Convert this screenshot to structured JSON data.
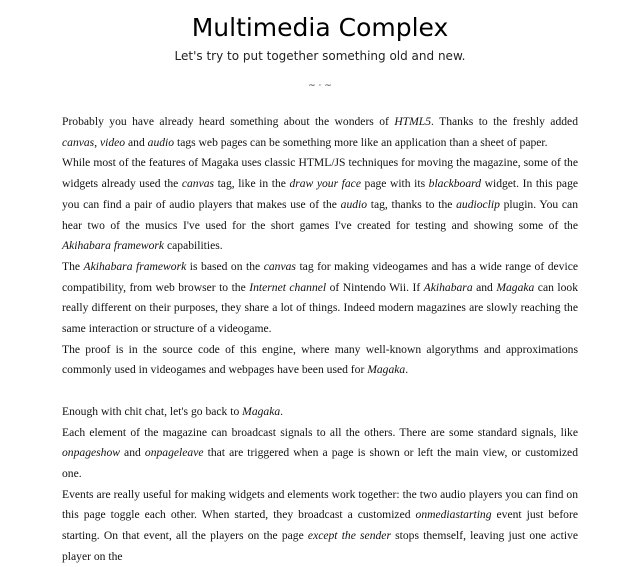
{
  "header": {
    "title": "Multimedia Complex",
    "subtitle": "Let's try to put together something old and new.",
    "divider": "~ · ~"
  },
  "paragraphs": [
    [
      {
        "t": "Probably you have already heard something about the wonders of "
      },
      {
        "t": "HTML5",
        "i": true
      },
      {
        "t": ". Thanks to the freshly added "
      },
      {
        "t": "canvas",
        "i": true
      },
      {
        "t": ", "
      },
      {
        "t": "video",
        "i": true
      },
      {
        "t": " and "
      },
      {
        "t": "audio",
        "i": true
      },
      {
        "t": " tags web pages can be something more like an application than a sheet of paper."
      }
    ],
    [
      {
        "t": "While most of the features of Magaka uses classic HTML/JS techniques for moving the magazine, some of the widgets already used the "
      },
      {
        "t": "canvas",
        "i": true
      },
      {
        "t": " tag, like in the "
      },
      {
        "t": "draw your face",
        "i": true
      },
      {
        "t": " page with its "
      },
      {
        "t": "blackboard",
        "i": true
      },
      {
        "t": " widget. In this page you can find a pair of audio players that makes use of the "
      },
      {
        "t": "audio",
        "i": true
      },
      {
        "t": " tag, thanks to the "
      },
      {
        "t": "audioclip",
        "i": true
      },
      {
        "t": " plugin. You can hear two of the musics I've used for the short games I've created for testing and showing some of the "
      },
      {
        "t": "Akihabara framework",
        "i": true
      },
      {
        "t": " capabilities."
      }
    ],
    [
      {
        "t": "The "
      },
      {
        "t": "Akihabara framework",
        "i": true
      },
      {
        "t": " is based on the "
      },
      {
        "t": "canvas",
        "i": true
      },
      {
        "t": " tag for making videogames and has a wide range of device compatibility, from web browser to the "
      },
      {
        "t": "Internet channel",
        "i": true
      },
      {
        "t": " of Nintendo Wii. If "
      },
      {
        "t": "Akihabara",
        "i": true
      },
      {
        "t": " and "
      },
      {
        "t": "Magaka",
        "i": true
      },
      {
        "t": " can look really different on their purposes, they share a lot of things. Indeed modern magazines are slowly reaching the same interaction or structure of a videogame."
      }
    ],
    [
      {
        "t": "The proof is in the source code of this engine, where many well-known algorythms and approximations commonly used in videogames and webpages have been used for "
      },
      {
        "t": "Magaka",
        "i": true
      },
      {
        "t": "."
      }
    ],
    null,
    [
      {
        "t": "Enough with chit chat, let's go back to "
      },
      {
        "t": "Magaka",
        "i": true
      },
      {
        "t": "."
      }
    ],
    [
      {
        "t": "Each element of the magazine can broadcast signals to all the others. There are some standard signals, like "
      },
      {
        "t": "onpageshow",
        "i": true
      },
      {
        "t": " and "
      },
      {
        "t": "onpageleave",
        "i": true
      },
      {
        "t": " that are triggered when a page is shown or left the main view, or customized one."
      }
    ],
    [
      {
        "t": "Events are really useful for making widgets and elements work together: the two audio players you can find on this page toggle each other. When started, they broadcast a customized "
      },
      {
        "t": "onmediastarting",
        "i": true
      },
      {
        "t": " event just before starting. On that event, all the players on the page "
      },
      {
        "t": "except the sender",
        "i": true
      },
      {
        "t": " stops themself, leaving just one active player on the"
      }
    ]
  ]
}
